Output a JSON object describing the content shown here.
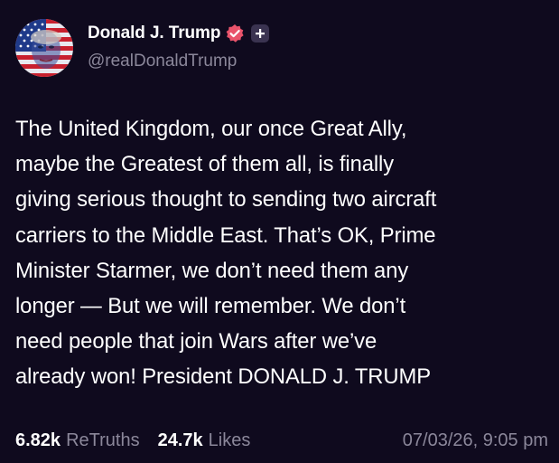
{
  "author": {
    "display_name": "Donald J. Trump",
    "handle": "@realDonaldTrump",
    "avatar_icon": "flag-face-avatar",
    "verified_icon": "verified-badge-icon",
    "verified_color": "#e9536b",
    "plus_icon": "plus-icon"
  },
  "post": {
    "lines": [
      "The United Kingdom, our once Great Ally,",
      "maybe the Greatest of them all, is finally",
      "giving serious thought to sending two aircraft",
      "carriers to the Middle East. That’s OK, Prime",
      "Minister Starmer, we don’t need them any",
      "longer — But we will remember. We don’t",
      "need people that join Wars after we’ve",
      "already won! President DONALD J. TRUMP"
    ]
  },
  "stats": {
    "retruths_count": "6.82k",
    "retruths_label": "ReTruths",
    "likes_count": "24.7k",
    "likes_label": "Likes",
    "timestamp": "07/03/26, 9:05 pm"
  },
  "colors": {
    "background": "#0f0a1e",
    "text": "#ffffff",
    "muted": "#8b879a"
  }
}
